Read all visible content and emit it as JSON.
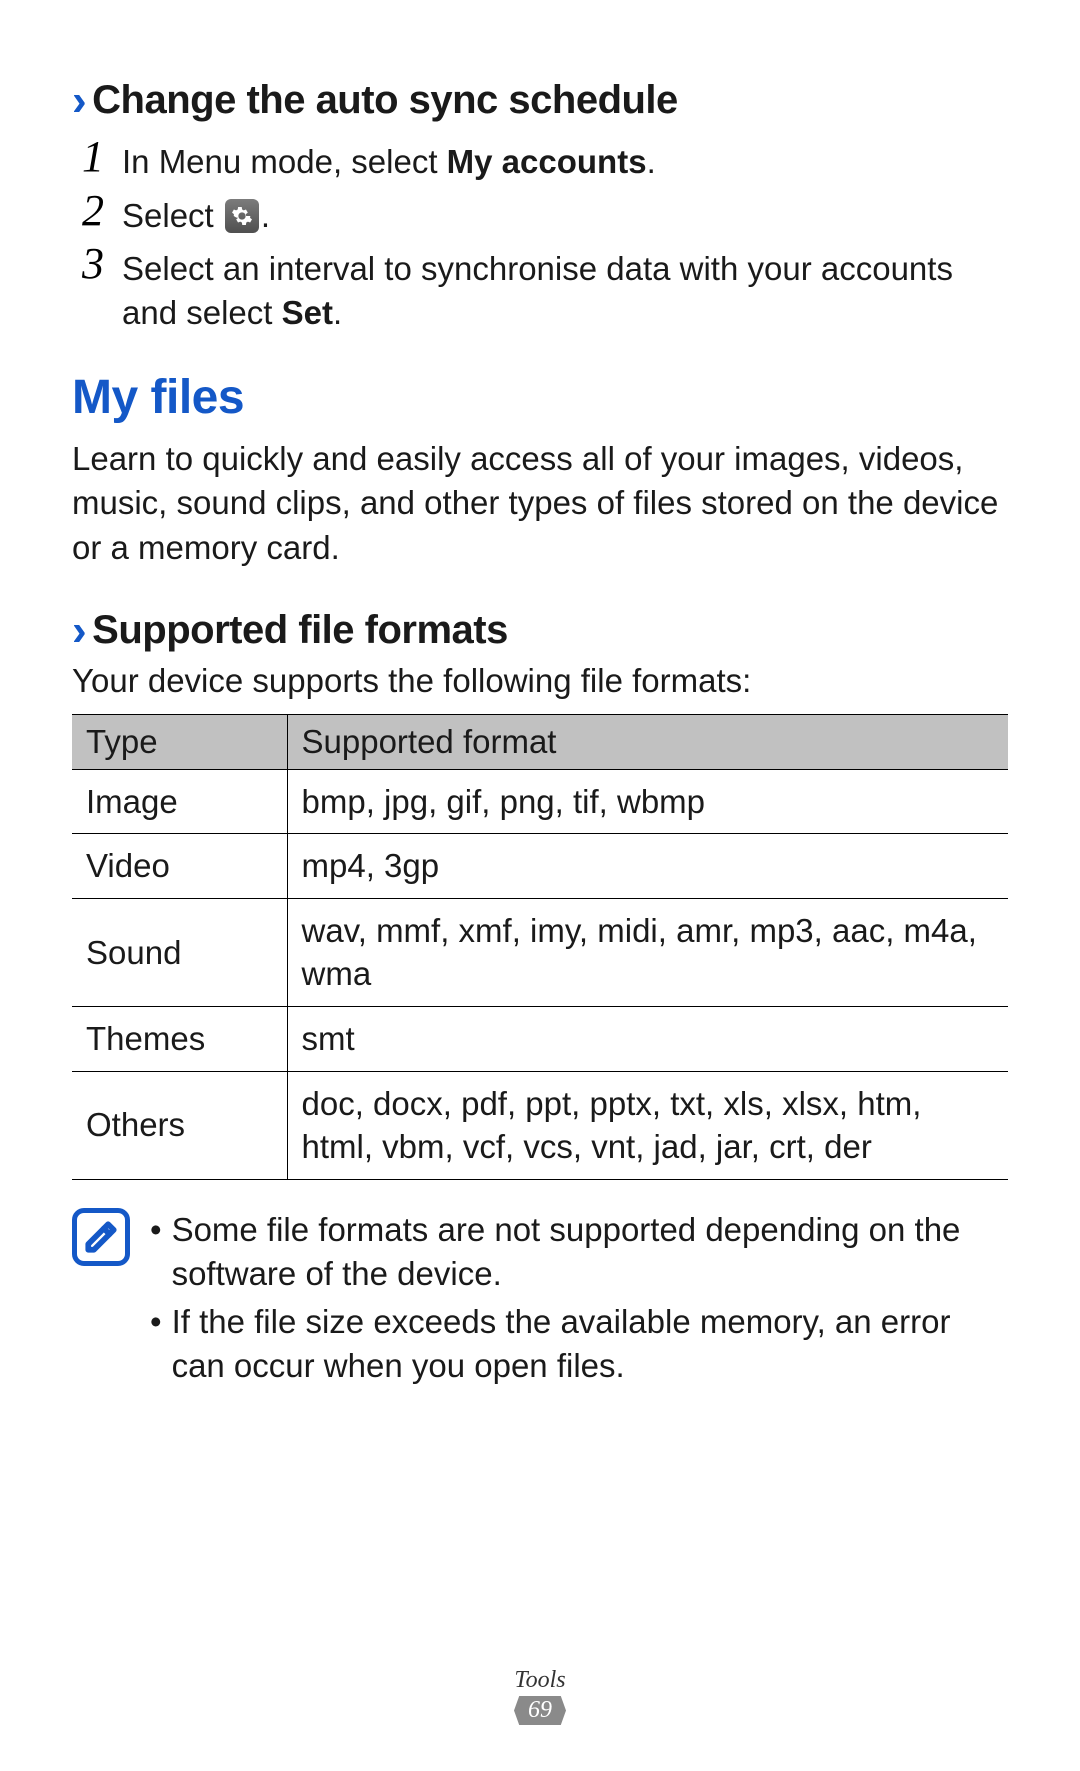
{
  "section1": {
    "title": "Change the auto sync schedule",
    "steps": [
      {
        "num": "1",
        "pre": "In Menu mode, select ",
        "bold": "My accounts",
        "post": "."
      },
      {
        "num": "2",
        "pre": "Select ",
        "post": "."
      },
      {
        "num": "3",
        "pre": "Select an interval to synchronise data with your accounts and select ",
        "bold": "Set",
        "post": "."
      }
    ]
  },
  "h2": "My files",
  "intro": "Learn to quickly and easily access all of your images, videos, music, sound clips, and other types of files stored on the device or a memory card.",
  "section2": {
    "title": "Supported file formats",
    "lead": "Your device supports the following file formats:",
    "table": {
      "head": {
        "c0": "Type",
        "c1": "Supported format"
      },
      "rows": [
        {
          "type": "Image",
          "fmt": "bmp, jpg, gif, png, tif, wbmp"
        },
        {
          "type": "Video",
          "fmt": "mp4, 3gp"
        },
        {
          "type": "Sound",
          "fmt": "wav, mmf, xmf, imy, midi, amr, mp3, aac, m4a, wma"
        },
        {
          "type": "Themes",
          "fmt": "smt"
        },
        {
          "type": "Others",
          "fmt": "doc, docx, pdf, ppt, pptx, txt, xls, xlsx, htm, html, vbm, vcf, vcs, vnt, jad, jar, crt, der"
        }
      ]
    }
  },
  "notes": [
    "Some file formats are not supported depending on the software of the device.",
    "If the file size exceeds the available memory, an error can occur when you open files."
  ],
  "footer": {
    "section": "Tools",
    "page": "69"
  }
}
